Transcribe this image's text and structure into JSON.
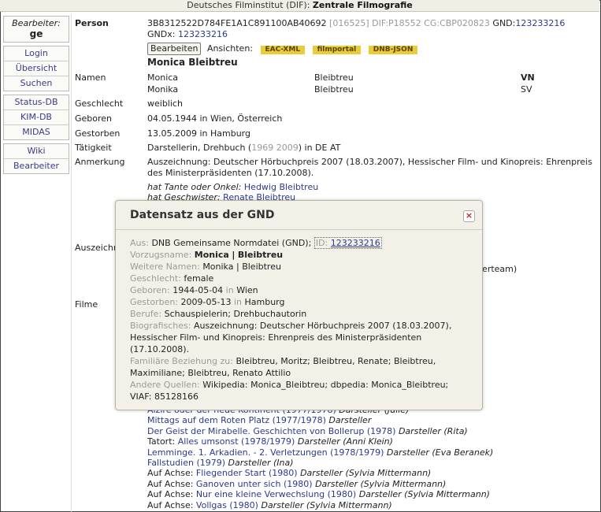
{
  "topbar": {
    "org": "Deutsches Filminstitut (DIF):",
    "title": "Zentrale Filmografie"
  },
  "sidebar": {
    "user_label": "Bearbeiter:",
    "user_name": "ge",
    "group1": [
      "Login",
      "Übersicht",
      "Suchen"
    ],
    "group2": [
      "Status-DB",
      "KIM-DB",
      "MIDAS"
    ],
    "group3": [
      "Wiki",
      "Bearbeiter"
    ]
  },
  "person": {
    "label": "Person",
    "id": "3B8312522D784FE1A1C891100AB40692",
    "num": "[016525]",
    "dif": "DIF:P18552",
    "cg": "CG:CBP020823",
    "gnd_label": "GND:",
    "gnd": "123233216",
    "gndx_label": "GNDx:",
    "gndx": "123233216",
    "edit_button": "Bearbeiten",
    "views_label": "Ansichten:",
    "views": [
      "EAC-XML",
      "filmportal",
      "DNB-JSON"
    ],
    "name_heading": "Monica Bleibtreu"
  },
  "fields": {
    "names_label": "Namen",
    "names": [
      {
        "first": "Monica",
        "last": "Bleibtreu",
        "type": "VN"
      },
      {
        "first": "Monika",
        "last": "Bleibtreu",
        "type": "SV"
      }
    ],
    "gender_label": "Geschlecht",
    "gender": "weiblich",
    "born_label": "Geboren",
    "born": "04.05.1944 in Wien, Österreich",
    "died_label": "Gestorben",
    "died": "13.05.2009 in Hamburg",
    "activity_label": "Tätigkeit",
    "activity_pre": "Darstellerin, Drehbuch (",
    "activity_years": "1969 2009",
    "activity_post": ") in DE AT",
    "note_label": "Anmerkung",
    "note_line1": "Auszeichnung: Deutscher Hörbuchpreis 2007 (18.03.2007), Hessischer Film- und Kinopreis: Ehrenpreis",
    "note_line2": "des Ministerpräsidenten (17.10.2008).",
    "rel1_label": "hat Tante oder Onkel:",
    "rel1": "Hedwig Bleibtreu",
    "rel2_label": "hat Geschwister:",
    "rel2": "Renate Bleibtreu",
    "awards_label": "Auszeichnungen",
    "awards_fragment": "lerteam)",
    "films_label": "Filme"
  },
  "films": [
    {
      "pre": "",
      "title": "Alzire oder der neue Kontinent (1977/1978)",
      "role": "Darsteller",
      "char": "(Julie)"
    },
    {
      "pre": "",
      "title": "Mittags auf dem Roten Platz (1977/1978)",
      "role": "Darsteller",
      "char": ""
    },
    {
      "pre": "",
      "title": "Der Geist der Mirabelle. Geschichten von Bollerup (1978)",
      "role": "Darsteller",
      "char": "(Rita)"
    },
    {
      "pre": "Tatort: ",
      "title": "Alles umsonst (1978/1979)",
      "role": "Darsteller",
      "char": "(Anni Klein)"
    },
    {
      "pre": "",
      "title": "Lemminge. 1. Arkadien. - 2. Verletzungen (1978/1979)",
      "role": "Darsteller",
      "char": "(Eva Beranek)"
    },
    {
      "pre": "",
      "title": "Fallstudien (1979)",
      "role": "Darsteller",
      "char": "(Ina)"
    },
    {
      "pre": "Auf Achse: ",
      "title": "Fliegender Start (1980)",
      "role": "Darsteller",
      "char": "(Sylvia Mittermann)"
    },
    {
      "pre": "Auf Achse: ",
      "title": "Ganoven unter sich (1980)",
      "role": "Darsteller",
      "char": "(Sylvia Mittermann)"
    },
    {
      "pre": "Auf Achse: ",
      "title": "Nur eine kleine Verwechslung (1980)",
      "role": "Darsteller",
      "char": "(Sylvia Mittermann)"
    },
    {
      "pre": "Auf Achse: ",
      "title": "Vollgas (1980)",
      "role": "Darsteller",
      "char": "(Sylvia Mittermann)"
    }
  ],
  "modal": {
    "title": "Datensatz aus der GND",
    "close": "×",
    "source_label": "Aus:",
    "source": "DNB Gemeinsame Normdatei (GND);",
    "id_label": "ID:",
    "id": "123233216",
    "pref_label": "Vorzugsname:",
    "pref_first": "Monica",
    "pref_sep": "|",
    "pref_last": "Bleibtreu",
    "other_label": "Weitere Namen:",
    "other_first": "Monika",
    "other_sep": "|",
    "other_last": "Bleibtreu",
    "gender_label": "Geschlecht:",
    "gender": "female",
    "born_label": "Geboren:",
    "born_date": "1944-05-04",
    "born_in": "in",
    "born_place": "Wien",
    "died_label": "Gestorben:",
    "died_date": "2009-05-13",
    "died_in": "in",
    "died_place": "Hamburg",
    "jobs_label": "Berufe:",
    "jobs": "Schauspielerin; Drehbuchautorin",
    "bio_label": "Biografisches:",
    "bio_line1": "Auszeichnung: Deutscher Hörbuchpreis 2007 (18.03.2007),",
    "bio_line2": "Hessischer Film- und Kinopreis: Ehrenpreis des Ministerpräsidenten",
    "bio_line3": "(17.10.2008).",
    "family_label": "Familiäre Beziehung zu:",
    "family_line1": "Bleibtreu, Moritz; Bleibtreu, Renate; Bleibtreu,",
    "family_line2": "Maximiliane; Bleibtreu, Renato Attilio",
    "sources_label": "Andere Quellen:",
    "sources": "Wikipedia: Monica_Bleibtreu; dbpedia: Monica_Bleibtreu;",
    "viaf": "VIAF: 85128166"
  }
}
